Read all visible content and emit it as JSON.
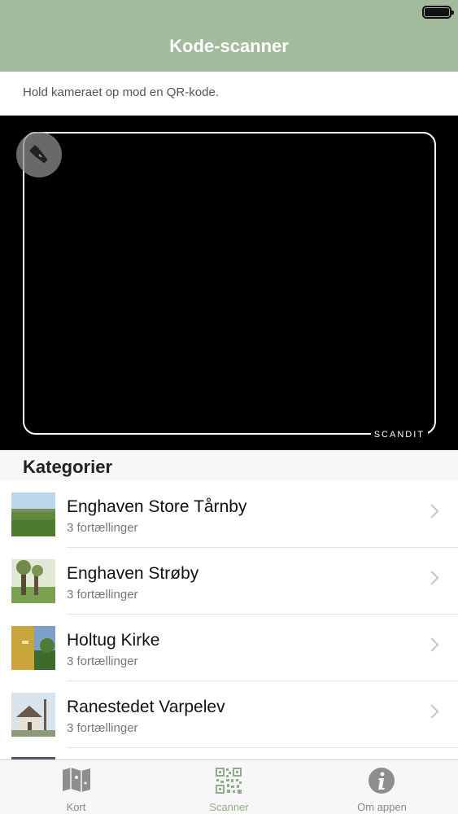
{
  "nav": {
    "title": "Kode-scanner"
  },
  "scanner": {
    "hint": "Hold kameraet op mod en QR-kode.",
    "brand": "SCANDIT"
  },
  "section": {
    "title": "Kategorier"
  },
  "categories": [
    {
      "title": "Enghaven Store Tårnby",
      "subtitle": "3 fortællinger"
    },
    {
      "title": "Enghaven Strøby",
      "subtitle": "3 fortællinger"
    },
    {
      "title": "Holtug Kirke",
      "subtitle": "3 fortællinger"
    },
    {
      "title": "Ranestedet Varpelev",
      "subtitle": "3 fortællinger"
    }
  ],
  "tabs": [
    {
      "label": "Kort",
      "icon": "map-icon"
    },
    {
      "label": "Scanner",
      "icon": "qr-code-icon",
      "active": true
    },
    {
      "label": "Om appen",
      "icon": "info-icon"
    }
  ],
  "colors": {
    "nav_bg": "#a3bb9c",
    "tab_active": "#8fae88",
    "tab_inactive": "#888888"
  }
}
